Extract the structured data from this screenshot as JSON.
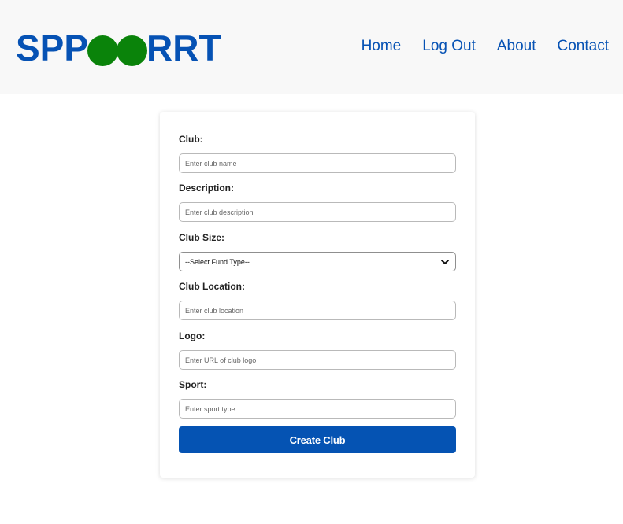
{
  "brand": {
    "prefix": "SPP",
    "suffix": "RRT",
    "brand_color": "#0652b4",
    "ball_color": "#0a830a"
  },
  "nav": {
    "items": [
      {
        "label": "Home"
      },
      {
        "label": "Log Out"
      },
      {
        "label": "About"
      },
      {
        "label": "Contact"
      }
    ]
  },
  "form": {
    "club": {
      "label": "Club:",
      "placeholder": "Enter club name",
      "value": ""
    },
    "description": {
      "label": "Description:",
      "placeholder": "Enter club description",
      "value": ""
    },
    "club_size": {
      "label": "Club Size:",
      "selected": "--Select Fund Type--",
      "icon": "chevron-down-icon"
    },
    "club_location": {
      "label": "Club Location:",
      "placeholder": "Enter club location",
      "value": ""
    },
    "logo": {
      "label": "Logo:",
      "placeholder": "Enter URL of club logo",
      "value": ""
    },
    "sport": {
      "label": "Sport:",
      "placeholder": "Enter sport type",
      "value": ""
    },
    "submit_label": "Create Club",
    "submit_color": "#0553b3"
  }
}
